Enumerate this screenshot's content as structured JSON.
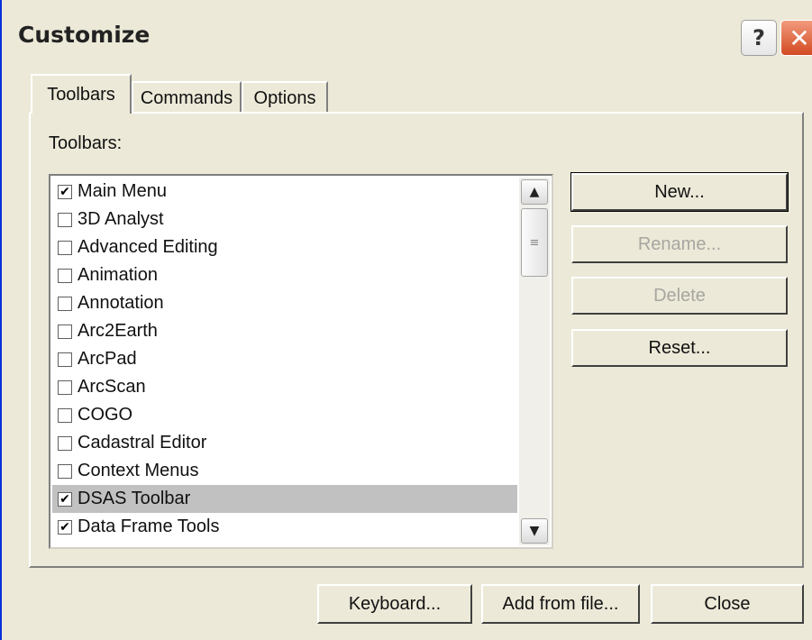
{
  "window": {
    "title": "Customize",
    "help_glyph": "?",
    "close_glyph": "✕"
  },
  "tabs": [
    {
      "label": "Toolbars",
      "active": true
    },
    {
      "label": "Commands",
      "active": false
    },
    {
      "label": "Options",
      "active": false
    }
  ],
  "toolbars_label": "Toolbars:",
  "toolbar_list": [
    {
      "label": "Main Menu",
      "checked": true,
      "selected": false
    },
    {
      "label": "3D Analyst",
      "checked": false,
      "selected": false
    },
    {
      "label": "Advanced Editing",
      "checked": false,
      "selected": false
    },
    {
      "label": "Animation",
      "checked": false,
      "selected": false
    },
    {
      "label": "Annotation",
      "checked": false,
      "selected": false
    },
    {
      "label": "Arc2Earth",
      "checked": false,
      "selected": false
    },
    {
      "label": "ArcPad",
      "checked": false,
      "selected": false
    },
    {
      "label": "ArcScan",
      "checked": false,
      "selected": false
    },
    {
      "label": "COGO",
      "checked": false,
      "selected": false
    },
    {
      "label": "Cadastral Editor",
      "checked": false,
      "selected": false
    },
    {
      "label": "Context Menus",
      "checked": false,
      "selected": false
    },
    {
      "label": "DSAS Toolbar",
      "checked": true,
      "selected": true
    },
    {
      "label": "Data Frame Tools",
      "checked": true,
      "selected": false
    }
  ],
  "scrollbar": {
    "up_glyph": "▲",
    "down_glyph": "▼",
    "thumb_glyph": "≡"
  },
  "side_buttons": {
    "new": "New...",
    "rename": "Rename...",
    "delete": "Delete",
    "reset": "Reset..."
  },
  "bottom_buttons": {
    "keyboard": "Keyboard...",
    "add_from_file": "Add from file...",
    "close": "Close"
  },
  "colors": {
    "dialog_bg": "#ece9d8",
    "selection": "#c1c1c1",
    "disabled_text": "#a7a6a0",
    "close_button": "#d24b22"
  }
}
